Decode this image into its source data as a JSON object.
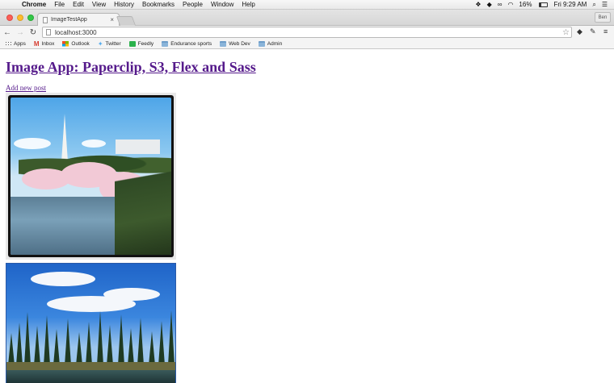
{
  "menubar": {
    "items": [
      "Chrome",
      "File",
      "Edit",
      "View",
      "History",
      "Bookmarks",
      "People",
      "Window",
      "Help"
    ],
    "battery": "16%",
    "battery_level": 0.16,
    "clock": "Fri 9:29 AM"
  },
  "browser": {
    "tab_title": "ImageTestApp",
    "profile": "Ben",
    "url": "localhost:3000"
  },
  "bookmarks": [
    {
      "label": "Apps",
      "icon": "apps-grid-icon"
    },
    {
      "label": "Inbox",
      "icon": "gmail-icon"
    },
    {
      "label": "Outlook",
      "icon": "outlook-icon"
    },
    {
      "label": "Twitter",
      "icon": "twitter-icon"
    },
    {
      "label": "Feedly",
      "icon": "feedly-icon"
    },
    {
      "label": "Endurance sports",
      "icon": "folder-icon"
    },
    {
      "label": "Web Dev",
      "icon": "folder-icon"
    },
    {
      "label": "Admin",
      "icon": "folder-icon"
    }
  ],
  "page": {
    "title": "Image App: Paperclip, S3, Flex and Sass",
    "add_post_link": "Add new post"
  },
  "colors": {
    "link_visited": "#551a8b",
    "close": "#fc5f57",
    "minimize": "#fdbc2e",
    "maximize": "#33c748"
  }
}
